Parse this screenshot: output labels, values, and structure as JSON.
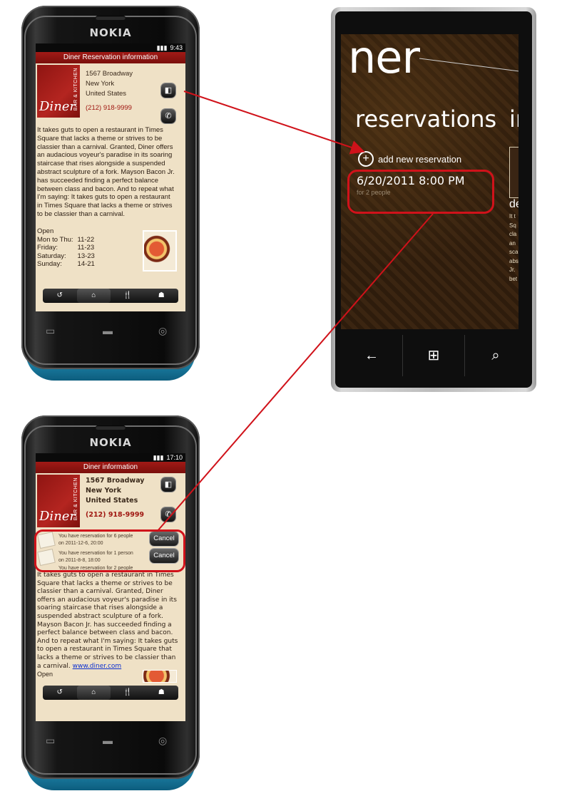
{
  "top_nokia": {
    "brand": "NOKIA",
    "status_time": "9:43",
    "title": "Diner Reservation information",
    "logo_word": "Diner",
    "logo_side": "BAR & KITCHEN",
    "address_line1": "1567 Broadway",
    "address_line2": "New York",
    "address_line3": "United States",
    "phone": "(212) 918-9999",
    "description": "It takes guts to open a restaurant in Times Square that lacks a theme or strives to be classier than a carnival. Granted, Diner offers an audacious voyeur's paradise in its soaring staircase that rises alongside a suspended abstract sculpture of a fork. Mayson Bacon Jr. has succeeded finding a perfect balance between class and bacon. And to repeat what I'm saying: It takes guts to open a restaurant in Times Square that lacks a theme or strives to be classier than a carnival.",
    "hours_heading": "Open",
    "hours": [
      {
        "day": "Mon to Thu:",
        "time": "11-22"
      },
      {
        "day": "Friday:",
        "time": "11-23"
      },
      {
        "day": "Saturday:",
        "time": "13-23"
      },
      {
        "day": "Sunday:",
        "time": "14-21"
      }
    ]
  },
  "bottom_nokia": {
    "brand": "NOKIA",
    "status_time": "17:10",
    "title": "Diner information",
    "logo_word": "Diner",
    "logo_side": "BAR & KITCHEN",
    "address_line1": "1567 Broadway",
    "address_line2": "New York",
    "address_line3": "United States",
    "phone": "(212) 918-9999",
    "reservations": [
      {
        "line1": "You have reservation for 6 people",
        "line2": "on 2011-12-6, 20:00",
        "action": "Cancel"
      },
      {
        "line1": "You have reservation for 1 person",
        "line2": "on 2011-8-8, 18:00",
        "action": "Cancel"
      },
      {
        "line1": "You have reservation for 2 people",
        "line2": "",
        "action": ""
      }
    ],
    "description": "It takes guts to open a restaurant in Times Square that lacks a theme or strives to be classier than a carnival. Granted, Diner offers an audacious voyeur's paradise in its soaring staircase that rises alongside a suspended abstract sculpture of a fork. Mayson Bacon Jr. has succeeded finding a perfect balance between class and bacon. And to repeat what I'm saying: It takes guts to open a restaurant in Times Square that lacks a theme or strives to be classier than a carnival.",
    "link": "www.diner.com",
    "hours_heading": "Open"
  },
  "windows_phone": {
    "hub_title": "ner",
    "pivot_current": "reservations",
    "pivot_next": "ir",
    "add_label": "add new reservation",
    "reservation_datetime": "6/20/2011 8:00 PM",
    "reservation_people": "for 2 people",
    "peek_heading": "de",
    "peek_text": [
      "It t",
      "Sq",
      "cla",
      "an",
      "sca",
      "abs",
      "Jr.",
      "bet"
    ]
  },
  "colors": {
    "accent_red": "#d0121a",
    "title_red": "#8f1512"
  }
}
